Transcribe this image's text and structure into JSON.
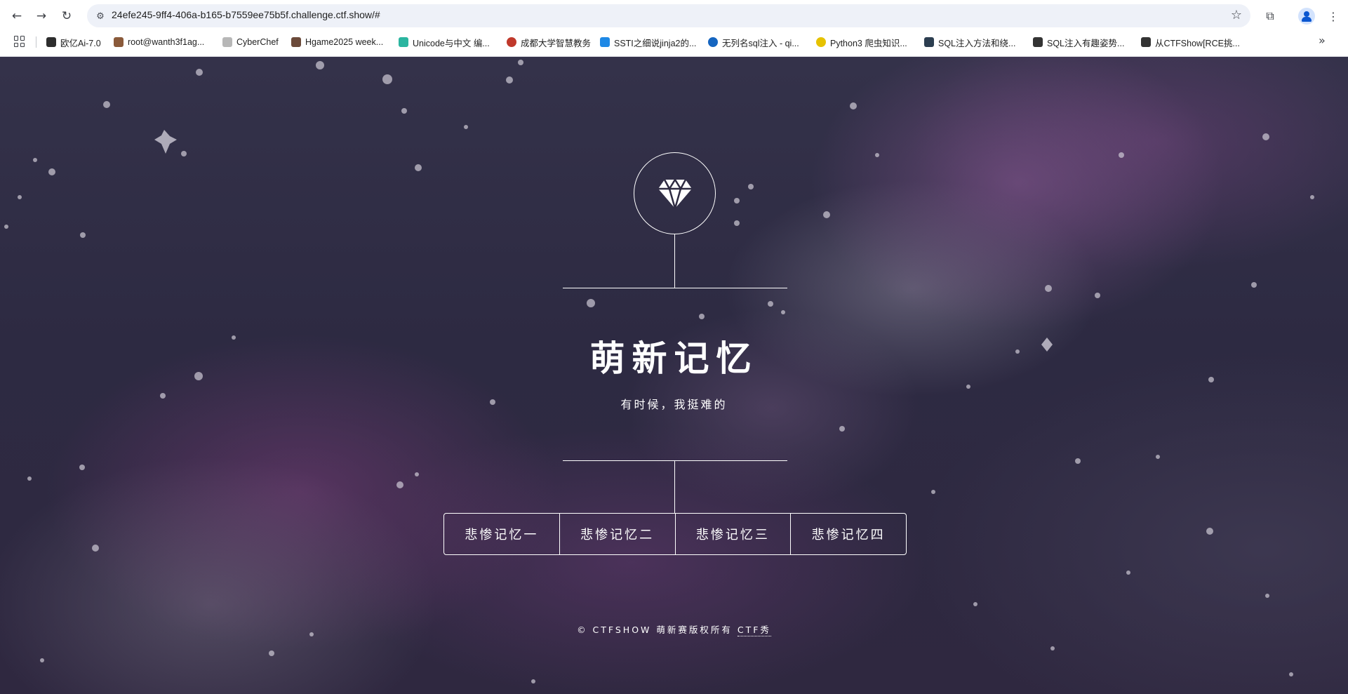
{
  "browser": {
    "url": "24efe245-9ff4-406a-b165-b7559ee75b5f.challenge.ctf.show/#",
    "bookmarks": [
      {
        "label": "欧亿Ai-7.0",
        "color": "#2d2d2d"
      },
      {
        "label": "root@wanth3f1ag...",
        "color": "#8a5a3a"
      },
      {
        "label": "CyberChef",
        "color": "#b7b7b7"
      },
      {
        "label": "Hgame2025 week...",
        "color": "#6b4a3a"
      },
      {
        "label": "Unicode与中文 编...",
        "color": "#2bb5a0"
      },
      {
        "label": "成都大学智慧教务",
        "color": "#c0392b"
      },
      {
        "label": "SSTI之细说jinja2的...",
        "color": "#1e88e5"
      },
      {
        "label": "无列名sql注入 - qi...",
        "color": "#1565c0"
      },
      {
        "label": "Python3 爬虫知识...",
        "color": "#e6c200"
      },
      {
        "label": "SQL注入方法和绕...",
        "color": "#2c3e50"
      },
      {
        "label": "SQL注入有趣姿势...",
        "color": "#333333"
      },
      {
        "label": "从CTFShow[RCE挑...",
        "color": "#333333"
      }
    ]
  },
  "site": {
    "title": "萌新记忆",
    "subtitle": "有时候，我挺难的",
    "menu": [
      "悲惨记忆一",
      "悲惨记忆二",
      "悲惨记忆三",
      "悲惨记忆四"
    ],
    "footer_text": "© CTFSHOW 萌新赛版权所有",
    "footer_link": "CTF秀"
  }
}
